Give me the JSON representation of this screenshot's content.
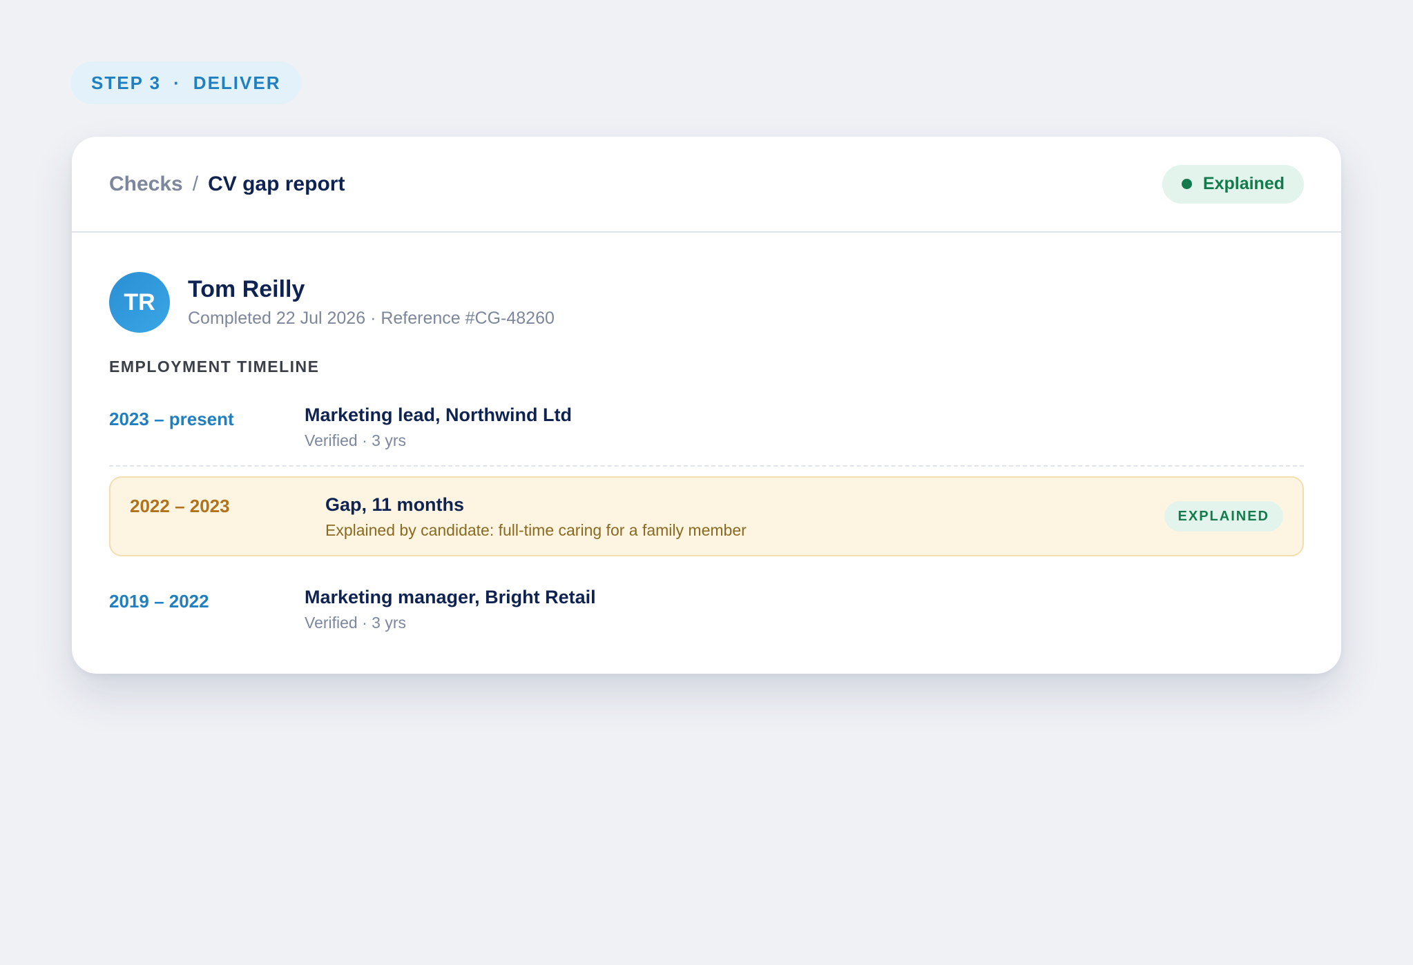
{
  "step": {
    "label": "STEP 3",
    "separator": "·",
    "phase": "DELIVER"
  },
  "breadcrumb": {
    "parent": "Checks",
    "separator": "/",
    "current": "CV gap report"
  },
  "status": {
    "label": "Explained",
    "color": "#137a4d"
  },
  "candidate": {
    "initials": "TR",
    "name": "Tom Reilly",
    "meta": "Completed 22 Jul 2026 · Reference #CG-48260"
  },
  "timeline": {
    "heading": "EMPLOYMENT TIMELINE",
    "entries": [
      {
        "dates": "2023 – present",
        "title": "Marketing lead, Northwind Ltd",
        "sub": "Verified · 3 yrs"
      },
      {
        "dates": "2022 – 2023",
        "title": "Gap, 11 months",
        "sub": "Explained by candidate: full-time caring for a family member",
        "badge": "EXPLAINED"
      },
      {
        "dates": "2019 – 2022",
        "title": "Marketing manager, Bright Retail",
        "sub": "Verified · 3 yrs"
      }
    ]
  },
  "colors": {
    "accent": "#1f7fc0",
    "gap_bg": "#fdf4e2",
    "gap_text": "#b0721a",
    "success": "#137a4d"
  }
}
